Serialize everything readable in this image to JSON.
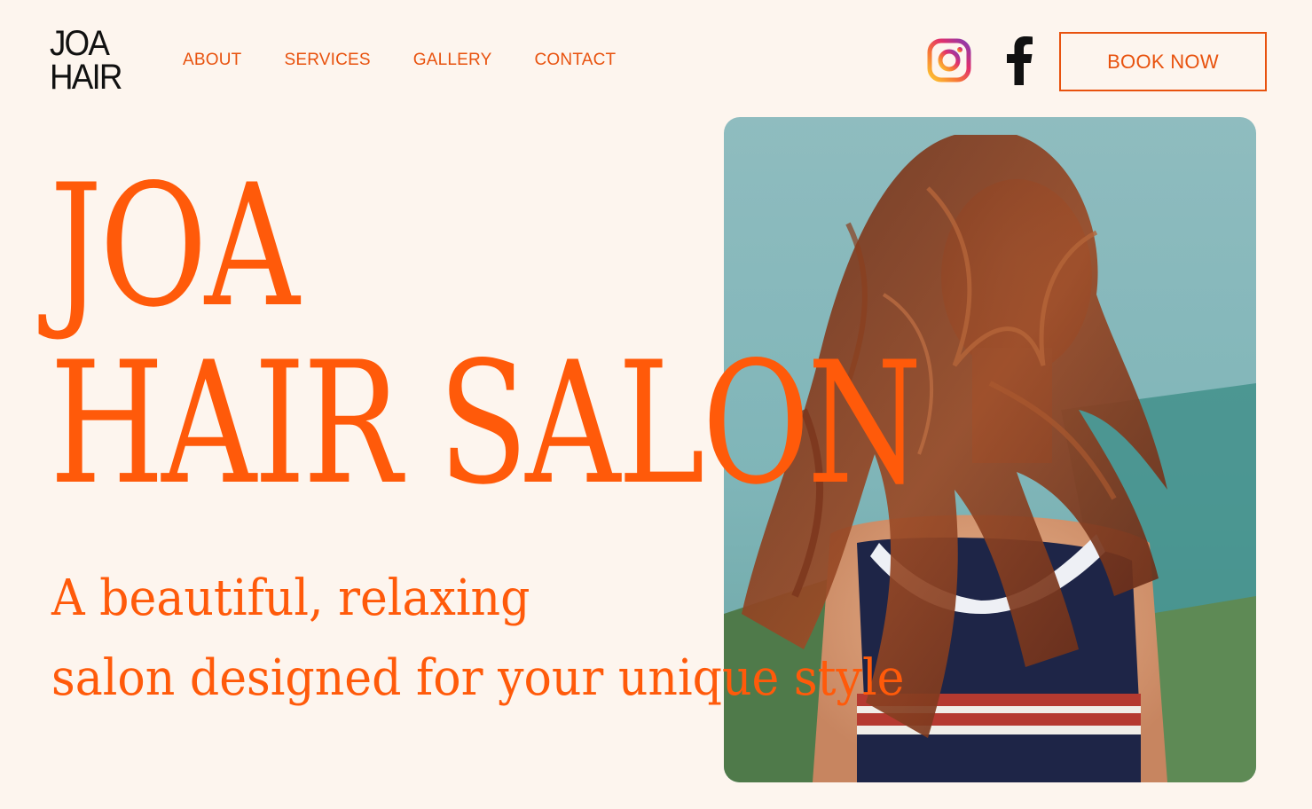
{
  "logo": {
    "line1": "JOA",
    "line2": "HAIR"
  },
  "nav": {
    "items": [
      {
        "label": "ABOUT"
      },
      {
        "label": "SERVICES"
      },
      {
        "label": "GALLERY"
      },
      {
        "label": "CONTACT"
      }
    ]
  },
  "social": {
    "instagram_icon": "instagram-icon",
    "facebook_icon": "facebook-icon"
  },
  "cta": {
    "book_label": "BOOK NOW"
  },
  "hero": {
    "title_line1": "JOA",
    "title_line2": "HAIR SALON",
    "tagline_line1": "A beautiful, relaxing",
    "tagline_line2": "salon designed for  your unique style"
  },
  "colors": {
    "accent": "#ff5a0a",
    "nav_text": "#e8520e",
    "background": "#fdf5ee",
    "logo": "#111111"
  }
}
